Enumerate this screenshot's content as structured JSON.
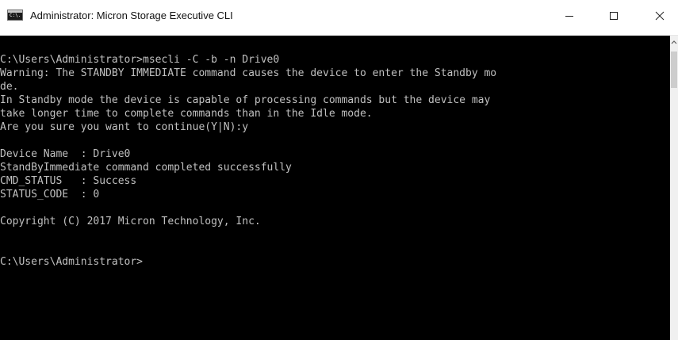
{
  "window": {
    "title": "Administrator: Micron Storage Executive CLI",
    "icon_text": "C:\\."
  },
  "controls": {
    "minimize": "minimize-icon",
    "maximize": "maximize-icon",
    "close": "close-icon"
  },
  "console": {
    "lines": [
      "C:\\Users\\Administrator>msecli -C -b -n Drive0",
      "Warning: The STANDBY IMMEDIATE command causes the device to enter the Standby mo",
      "de.",
      "In Standby mode the device is capable of processing commands but the device may",
      "take longer time to complete commands than in the Idle mode.",
      "Are you sure you want to continue(Y|N):y",
      "",
      "Device Name  : Drive0",
      "StandByImmediate command completed successfully",
      "CMD_STATUS   : Success",
      "STATUS_CODE  : 0",
      "",
      "Copyright (C) 2017 Micron Technology, Inc.",
      "",
      "",
      "C:\\Users\\Administrator>"
    ]
  },
  "colors": {
    "console_bg": "#000000",
    "console_text": "#c0c0c0",
    "titlebar_bg": "#ffffff"
  }
}
